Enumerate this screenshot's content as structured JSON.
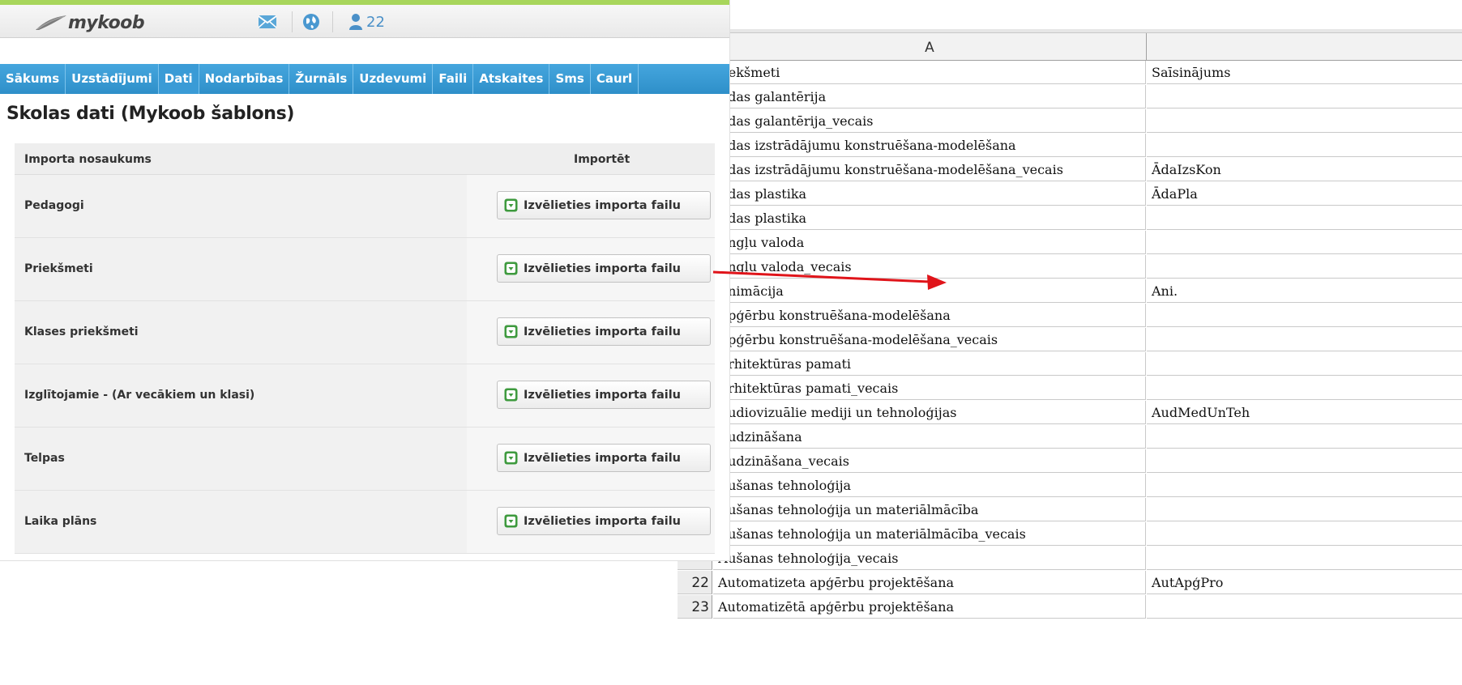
{
  "app": {
    "logo_text": "mykoob",
    "user_count": "22",
    "brand_color": "#2e8fc9",
    "accent_green": "#a8d65c"
  },
  "icons": {
    "mail": "mail-icon",
    "globe": "globe-icon",
    "users": "users-icon",
    "import": "import-icon"
  },
  "nav": {
    "items": [
      {
        "label": "Sākums"
      },
      {
        "label": "Uzstādījumi"
      },
      {
        "label": "Dati"
      },
      {
        "label": "Nodarbības"
      },
      {
        "label": "Žurnāls"
      },
      {
        "label": "Uzdevumi"
      },
      {
        "label": "Faili"
      },
      {
        "label": "Atskaites"
      },
      {
        "label": "Sms"
      },
      {
        "label": "Caurl"
      }
    ]
  },
  "page": {
    "title": "Skolas dati (Mykoob šablons)"
  },
  "import_table": {
    "header_name": "Importa nosaukums",
    "header_import": "Importēt",
    "rows": [
      {
        "name": "Pedagogi",
        "button": "Izvēlieties importa failu"
      },
      {
        "name": "Priekšmeti",
        "button": "Izvēlieties importa failu"
      },
      {
        "name": "Klases priekšmeti",
        "button": "Izvēlieties importa failu"
      },
      {
        "name": "Izglītojamie - (Ar vecākiem un klasi)",
        "button": "Izvēlieties importa failu"
      },
      {
        "name": "Telpas",
        "button": "Izvēlieties importa failu"
      },
      {
        "name": "Laika plāns",
        "button": "Izvēlieties importa failu"
      }
    ]
  },
  "spreadsheet": {
    "col_a": "A",
    "col_b": "",
    "rows": [
      {
        "num": "",
        "a": "riekšmeti",
        "b": "Saīsinājums"
      },
      {
        "num": "",
        "a": "Аdas galantērija",
        "b": ""
      },
      {
        "num": "",
        "a": "Аdas galantērija_vecais",
        "b": ""
      },
      {
        "num": "",
        "a": "Аdas izstrādājumu konstruēšana-modelēšana",
        "b": ""
      },
      {
        "num": "",
        "a": "Аdas izstrādājumu konstruēšana-modelēšana_vecais",
        "b": "ĀdaIzsKon"
      },
      {
        "num": "",
        "a": "Аdas plastika",
        "b": "ĀdaPla"
      },
      {
        "num": "",
        "a": "Аdas plastika",
        "b": ""
      },
      {
        "num": "",
        "a": "Аngļu valoda",
        "b": ""
      },
      {
        "num": "",
        "a": "Аngļu valoda_vecais",
        "b": ""
      },
      {
        "num": "",
        "a": "Аnimācija",
        "b": "Ani."
      },
      {
        "num": "",
        "a": "Аpģērbu konstruēšana-modelēšana",
        "b": ""
      },
      {
        "num": "",
        "a": "Аpģērbu konstruēšana-modelēšana_vecais",
        "b": ""
      },
      {
        "num": "",
        "a": "Аrhitektūras pamati",
        "b": ""
      },
      {
        "num": "",
        "a": "Аrhitektūras pamati_vecais",
        "b": ""
      },
      {
        "num": "",
        "a": "Аudiovizuālie mediji un tehnoloģijas",
        "b": "AudMedUnTeh"
      },
      {
        "num": "",
        "a": "Аudzināšana",
        "b": ""
      },
      {
        "num": "",
        "a": "Аudzināšana_vecais",
        "b": ""
      },
      {
        "num": "",
        "a": "Аušanas tehnoloģija",
        "b": ""
      },
      {
        "num": "",
        "a": "Аušanas tehnoloģija un materiālmācība",
        "b": ""
      },
      {
        "num": "",
        "a": "Аušanas tehnoloģija un materiālmācība_vecais",
        "b": ""
      },
      {
        "num": "",
        "a": "Аušanas tehnoloģija_vecais",
        "b": ""
      },
      {
        "num": "22",
        "a": "Automatizeta apģērbu projektēšana",
        "b": "AutApģPro"
      },
      {
        "num": "23",
        "a": "Automatizētā apģērbu projektēšana",
        "b": ""
      }
    ]
  }
}
